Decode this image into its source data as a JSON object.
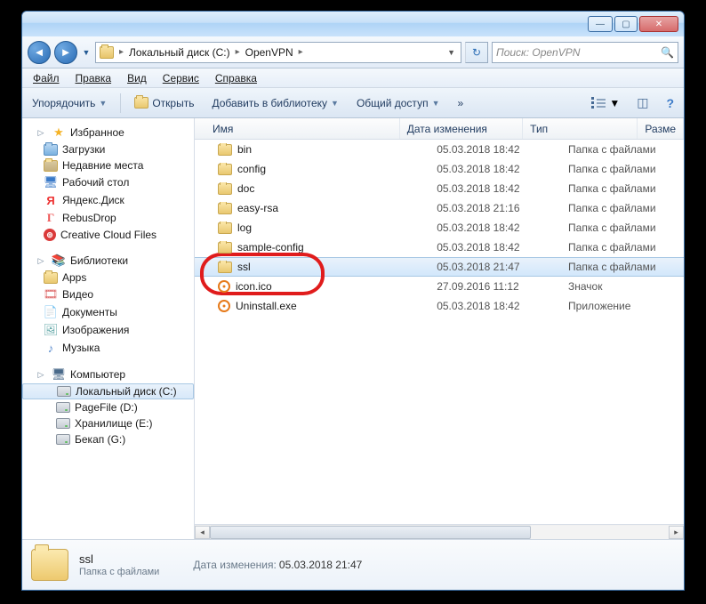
{
  "titlebar": {
    "min": "—",
    "max": "▢",
    "close": "✕"
  },
  "nav": {
    "back": "◄",
    "fwd": "►",
    "crumbs": [
      "Локальный диск (C:)",
      "OpenVPN"
    ],
    "search_placeholder": "Поиск: OpenVPN",
    "refresh": "↻"
  },
  "menu": [
    "Файл",
    "Правка",
    "Вид",
    "Сервис",
    "Справка"
  ],
  "toolbar": {
    "organize": "Упорядочить",
    "open": "Открыть",
    "library": "Добавить в библиотеку",
    "share": "Общий доступ",
    "more": "»",
    "help": "?"
  },
  "sidebar": {
    "fav_label": "Избранное",
    "fav": [
      "Загрузки",
      "Недавние места",
      "Рабочий стол",
      "Яндекс.Диск",
      "RebusDrop",
      "Creative Cloud Files"
    ],
    "lib_label": "Библиотеки",
    "lib": [
      "Apps",
      "Видео",
      "Документы",
      "Изображения",
      "Музыка"
    ],
    "comp_label": "Компьютер",
    "drives": [
      "Локальный диск (C:)",
      "PageFile (D:)",
      "Хранилище (E:)",
      "Бекап (G:)"
    ]
  },
  "columns": {
    "name": "Имя",
    "date": "Дата изменения",
    "type": "Тип",
    "size": "Разме"
  },
  "files": [
    {
      "icon": "folder",
      "name": "bin",
      "date": "05.03.2018 18:42",
      "type": "Папка с файлами"
    },
    {
      "icon": "folder",
      "name": "config",
      "date": "05.03.2018 18:42",
      "type": "Папка с файлами"
    },
    {
      "icon": "folder",
      "name": "doc",
      "date": "05.03.2018 18:42",
      "type": "Папка с файлами"
    },
    {
      "icon": "folder",
      "name": "easy-rsa",
      "date": "05.03.2018 21:16",
      "type": "Папка с файлами"
    },
    {
      "icon": "folder",
      "name": "log",
      "date": "05.03.2018 18:42",
      "type": "Папка с файлами"
    },
    {
      "icon": "folder",
      "name": "sample-config",
      "date": "05.03.2018 18:42",
      "type": "Папка с файлами"
    },
    {
      "icon": "folder",
      "name": "ssl",
      "date": "05.03.2018 21:47",
      "type": "Папка с файлами",
      "selected": true
    },
    {
      "icon": "ovpn",
      "name": "icon.ico",
      "date": "27.09.2016 11:12",
      "type": "Значок"
    },
    {
      "icon": "ovpn",
      "name": "Uninstall.exe",
      "date": "05.03.2018 18:42",
      "type": "Приложение"
    }
  ],
  "details": {
    "name": "ssl",
    "type": "Папка с файлами",
    "meta_label": "Дата изменения:",
    "meta_value": "05.03.2018 21:47"
  }
}
